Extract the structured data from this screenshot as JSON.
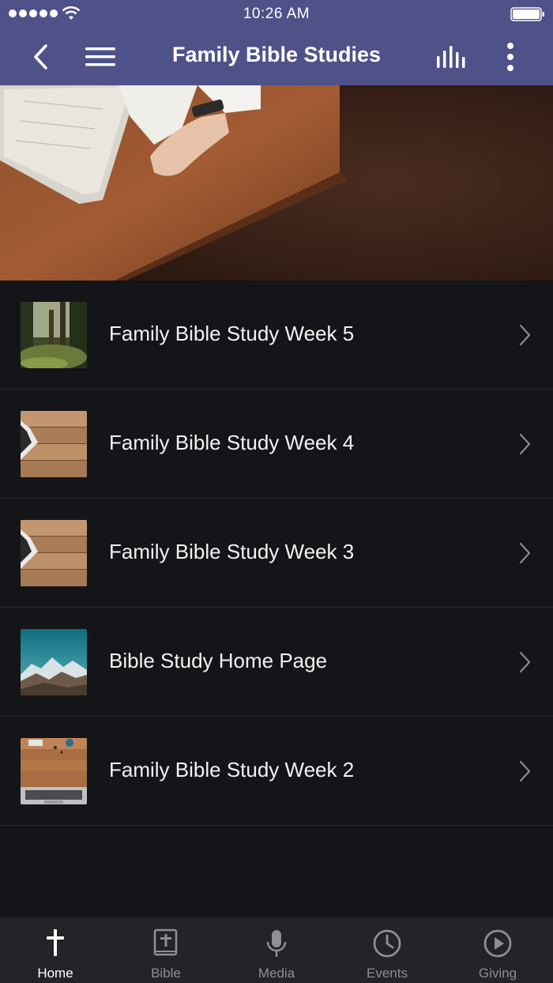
{
  "status_bar": {
    "time": "10:26 AM"
  },
  "header": {
    "title": "Family Bible Studies"
  },
  "list": {
    "items": [
      {
        "label": "Family Bible Study Week 5",
        "thumb": "forest"
      },
      {
        "label": "Family Bible Study Week 4",
        "thumb": "wood-tablet"
      },
      {
        "label": "Family Bible Study Week 3",
        "thumb": "wood-tablet"
      },
      {
        "label": "Bible Study Home Page",
        "thumb": "mountains"
      },
      {
        "label": "Family Bible Study Week 2",
        "thumb": "desk-laptop"
      }
    ]
  },
  "tabs": [
    {
      "label": "Home",
      "icon": "cross-icon",
      "active": true
    },
    {
      "label": "Bible",
      "icon": "bible-icon",
      "active": false
    },
    {
      "label": "Media",
      "icon": "microphone-icon",
      "active": false
    },
    {
      "label": "Events",
      "icon": "clock-icon",
      "active": false
    },
    {
      "label": "Giving",
      "icon": "play-circle-icon",
      "active": false
    }
  ]
}
